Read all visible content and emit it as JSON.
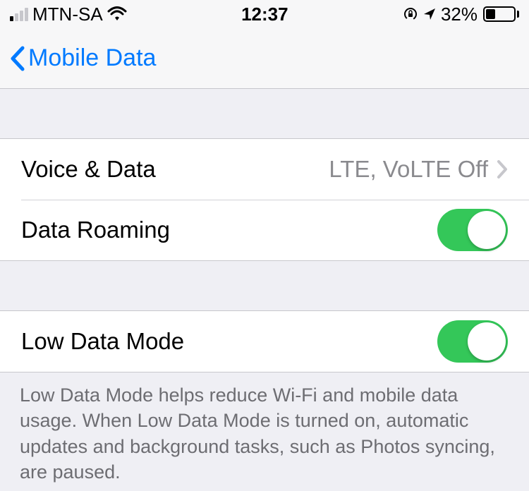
{
  "status": {
    "carrier": "MTN-SA",
    "time": "12:37",
    "battery_percent_text": "32%",
    "battery_fill_percent": 32,
    "signal_active_bars": 1
  },
  "nav": {
    "back_label": "Mobile Data"
  },
  "cells": {
    "voice_data": {
      "label": "Voice & Data",
      "value": "LTE, VoLTE Off"
    },
    "data_roaming": {
      "label": "Data Roaming",
      "on": true
    },
    "low_data_mode": {
      "label": "Low Data Mode",
      "on": true
    }
  },
  "footer": {
    "low_data_mode_explain": "Low Data Mode helps reduce Wi-Fi and mobile data usage. When Low Data Mode is turned on, automatic updates and background tasks, such as Photos syncing, are paused."
  }
}
